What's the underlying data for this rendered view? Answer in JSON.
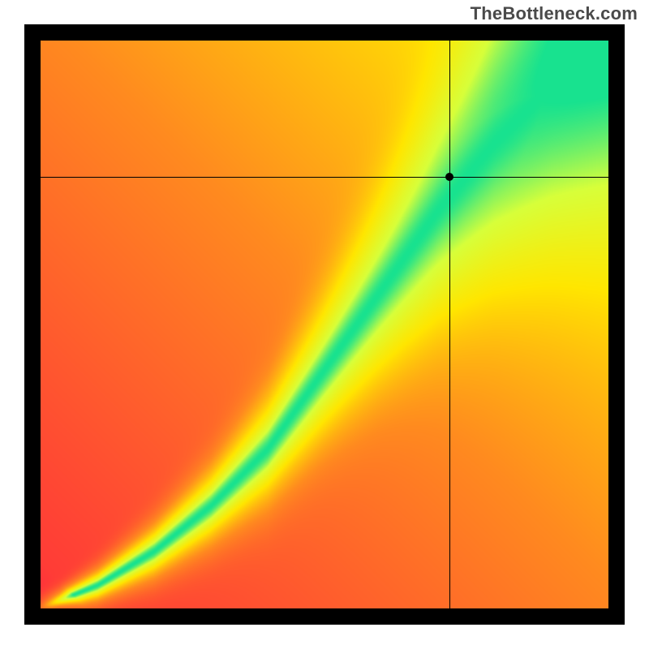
{
  "watermark": "TheBottleneck.com",
  "chart_data": {
    "type": "heatmap",
    "title": "",
    "xlabel": "",
    "ylabel": "",
    "x_range": [
      0,
      100
    ],
    "y_range": [
      0,
      100
    ],
    "grid": false,
    "colorscale": [
      {
        "stop": 0.0,
        "color": "#ff2a3c"
      },
      {
        "stop": 0.35,
        "color": "#ff8a1f"
      },
      {
        "stop": 0.6,
        "color": "#ffe600"
      },
      {
        "stop": 0.82,
        "color": "#d7ff3a"
      },
      {
        "stop": 1.0,
        "color": "#18e28f"
      }
    ],
    "ridge": [
      {
        "x": 0,
        "y": 0,
        "half_width": 0.4
      },
      {
        "x": 10,
        "y": 4,
        "half_width": 1.0
      },
      {
        "x": 20,
        "y": 10,
        "half_width": 1.6
      },
      {
        "x": 30,
        "y": 18,
        "half_width": 2.2
      },
      {
        "x": 40,
        "y": 28,
        "half_width": 3.0
      },
      {
        "x": 50,
        "y": 42,
        "half_width": 3.8
      },
      {
        "x": 60,
        "y": 56,
        "half_width": 4.8
      },
      {
        "x": 70,
        "y": 70,
        "half_width": 6.0
      },
      {
        "x": 80,
        "y": 82,
        "half_width": 7.4
      },
      {
        "x": 90,
        "y": 92,
        "half_width": 8.8
      },
      {
        "x": 100,
        "y": 100,
        "half_width": 10.0
      }
    ],
    "marker": {
      "x": 72,
      "y": 76
    },
    "crosshair": {
      "x": 72,
      "y": 76
    },
    "background_gradient": {
      "bottom_left": "#ff2a3c",
      "top_left": "#ff2a3c",
      "bottom_right": "#ff2a3c",
      "top_right": "#ffe600",
      "note": "Sum-based warm field with green ridge along optimal diagonal"
    }
  }
}
